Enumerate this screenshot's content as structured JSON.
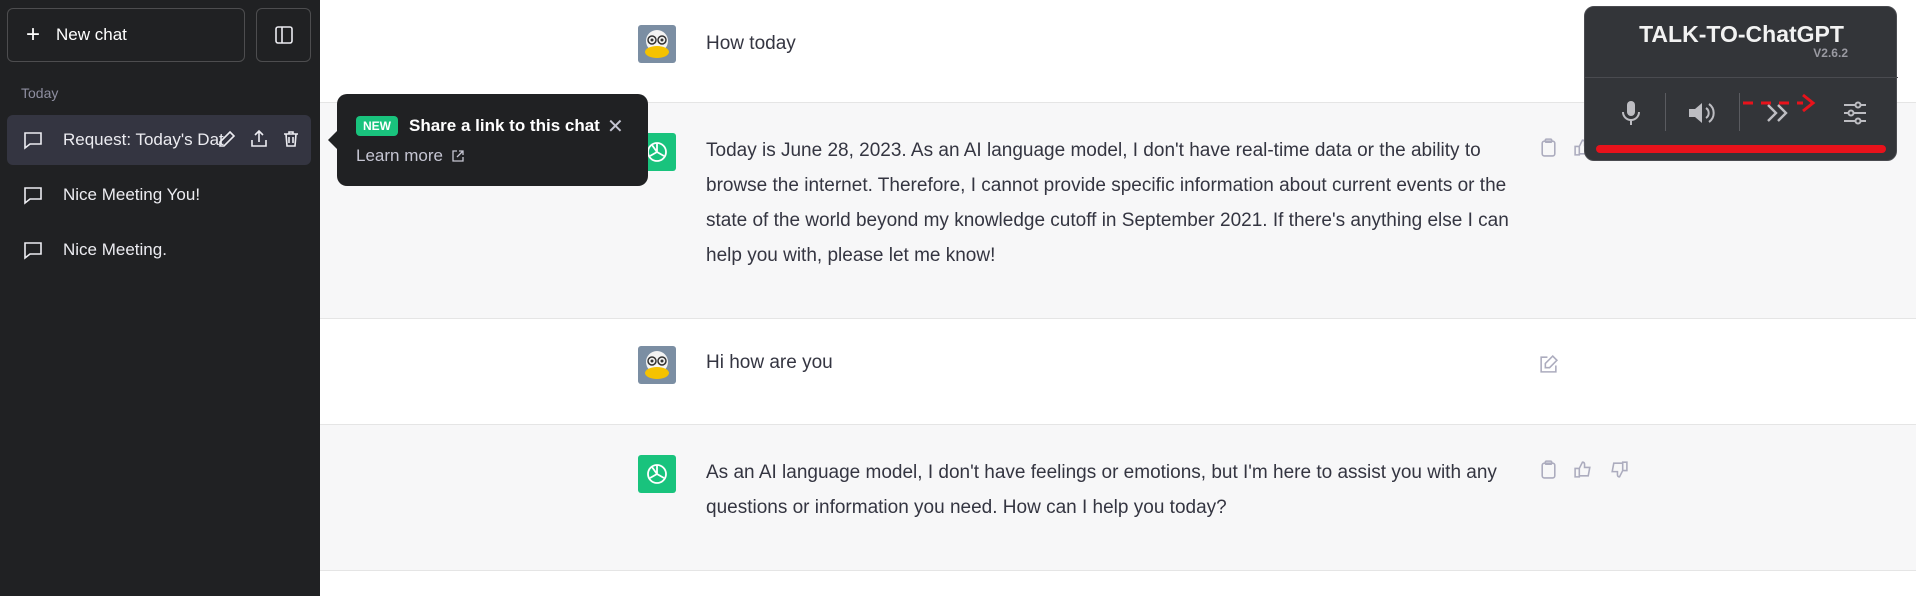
{
  "sidebar": {
    "new_chat_label": "New chat",
    "section_label": "Today",
    "items": [
      {
        "label": "Request: Today's Dat",
        "active": true
      },
      {
        "label": "Nice Meeting You!",
        "active": false
      },
      {
        "label": "Nice Meeting.",
        "active": false
      }
    ]
  },
  "popup": {
    "badge": "NEW",
    "title": "Share a link to this chat",
    "close": "✕",
    "learn_more": "Learn more"
  },
  "messages": [
    {
      "role": "user",
      "text": "How today"
    },
    {
      "role": "assistant",
      "text": "Today is June 28, 2023. As an AI language model, I don't have real-time data or the ability to browse the internet. Therefore, I cannot provide specific information about current events or the state of the world beyond my knowledge cutoff in September 2021. If there's anything else I can help you with, please let me know!"
    },
    {
      "role": "user",
      "text": "Hi how are you"
    },
    {
      "role": "assistant",
      "text": "As an AI language model, I don't have feelings or emotions, but I'm here to assist you with any questions or information you need. How can I help you today?"
    }
  ],
  "talk_widget": {
    "title": "TALK-TO-ChatGPT",
    "version": "V2.6.2",
    "buttons": [
      "microphone-icon",
      "speaker-icon",
      "skip-icon",
      "settings-sliders-icon"
    ]
  },
  "colors": {
    "sidebar_bg": "#202123",
    "accent_green": "#19c37d",
    "assistant_bg": "#f7f7f8",
    "widget_bar_red": "#e8121b"
  }
}
